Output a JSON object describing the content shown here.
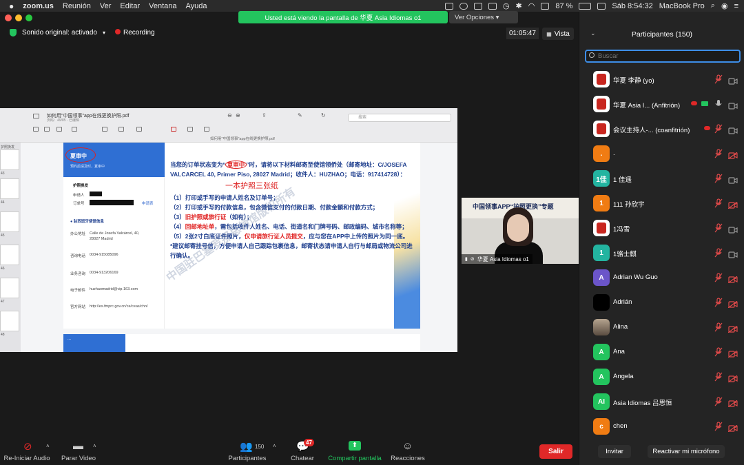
{
  "menubar": {
    "app_name": "zoom.us",
    "items": [
      "Reunión",
      "Ver",
      "Editar",
      "Ventana",
      "Ayuda"
    ],
    "battery": "87 %",
    "datetime": "Sáb 8:54:32",
    "device": "MacBook Pro"
  },
  "share_banner": {
    "text": "Usted está viendo la pantalla de 华夏 Asia Idiomas o1",
    "view_options": "Ver Opciones ▾"
  },
  "meeting": {
    "audio_status": "Sonido original: activado",
    "recording_label": "Recording",
    "timer": "01:05:47",
    "view_label": "Vista"
  },
  "shared_screen": {
    "pdf_title": "如何用\"中国领事\"app在线更换护照.pdf",
    "pdf_subtitle": "页码：49/85 · 已编辑",
    "pdf_filename": "如何用\"中国领事\"app在线更换护照.pdf",
    "search_placeholder": "搜索",
    "thumb_numbers": [
      "43",
      "44",
      "45",
      "46",
      "47",
      "48"
    ],
    "thumb_label": "护照换发",
    "phone": {
      "status": "夏审中",
      "status_sub": "预约后请及时，夏审中",
      "section1": "护照换发",
      "field_applicant": "申请人",
      "field_order": "订单号",
      "order_status": "申请表",
      "section2": "● 驻西班牙使馆信息",
      "addr_label": "办公地址",
      "addr_value": "Calle de Josefa Valcárcel, 40, 28027 Madrid",
      "tel1_label": "咨询电话",
      "tel1_value": "0034-915085096",
      "tel2_label": "业务咨询",
      "tel2_value": "0034-913206169",
      "email_label": "电子邮件",
      "email_value": "huzhaomadrid@vip.163.com",
      "web_label": "官方网站",
      "web_value": "http://es.fmprc.gov.cn/ce/ceas/chn/"
    },
    "body": {
      "p1a": "当您的订单状态变为“",
      "p1_status": "复审中",
      "p1b": "”时，请将以下材料邮寄至使馆领侨处（邮寄地址：C/JOSEFA VALCARCEL 40, Primer Piso, 28027 Madrid；收件人：HUZHAO；电话：917414728）：",
      "handwritten": "一本护照三张纸",
      "l1": "（1）打印或手写的申请人姓名及订单号；",
      "l2": "（2）打印或手写的付款信息，包含微信支付的付款日期、付款金额和付款方式；",
      "l3a": "（3）",
      "l3_red": "旧护照或旅行证",
      "l3b": "（如有）；",
      "l4a": "（4）",
      "l4_red": "回邮地址单",
      "l4b": "，需包括收件人姓名、电话、街道名和门牌号码、邮政编码、城市名称等；",
      "l5a": "（5）2张2寸白底证件照片，",
      "l5_red": "仅申请旅行证人员提交",
      "l5b": "，应与您在APP中上传的照片为同一底。",
      "note": "*建议邮寄挂号信，方便申请人自己跟踪包裹信息，邮寄状态请申请人自行与邮局或物流公司进行确认。"
    },
    "watermark": "中国驻巴塞罗那总领馆版权所有",
    "bottom_slide_label": "..."
  },
  "video": {
    "banner_text": "中国领事APP“护照更换”专题",
    "name": "华夏 Asia Idiomas o1"
  },
  "toolbar": {
    "audio": "Re-Iniciar Audio",
    "video": "Parar Video",
    "participants": "Participantes",
    "participants_count": "150",
    "chat": "Chatear",
    "chat_badge": "47",
    "share": "Compartir pantalla",
    "reactions": "Reacciones",
    "leave": "Salir"
  },
  "panel": {
    "title": "Participantes (150)",
    "search_placeholder": "Buscar",
    "invite": "Invitar",
    "unmute": "Reactivar mi micrófono",
    "participants": [
      {
        "name": "华夏 李静 (yo)",
        "avatar": "logo",
        "color": "#ffffff"
      },
      {
        "name": "华夏 Asia I...  (Anfitrión)",
        "avatar": "logo",
        "color": "#ffffff"
      },
      {
        "name": "会议主持人-...  (coanfitrión)",
        "avatar": "logo",
        "color": "#ffffff"
      },
      {
        "name": ".",
        "avatar": ".",
        "color": "#f07c13"
      },
      {
        "name": "1 佳遥",
        "avatar": "1佳",
        "color": "#23b4a0"
      },
      {
        "name": "111 孙欣宇",
        "avatar": "1",
        "color": "#f07c13"
      },
      {
        "name": "1冯雪",
        "avatar": "logo",
        "color": "#ffffff"
      },
      {
        "name": "1骆士麒",
        "avatar": "1",
        "color": "#23b4a0"
      },
      {
        "name": "Adrian Wu Guo",
        "avatar": "A",
        "color": "#6b55c9"
      },
      {
        "name": "Adrián",
        "avatar": "",
        "color": "#000000"
      },
      {
        "name": "Alina",
        "avatar": "photo",
        "color": "#8a7a6a"
      },
      {
        "name": "Ana",
        "avatar": "A",
        "color": "#23c45e"
      },
      {
        "name": "Angela",
        "avatar": "A",
        "color": "#23c45e"
      },
      {
        "name": "Asia Idiomas 吕思恒",
        "avatar": "AI",
        "color": "#23c45e"
      },
      {
        "name": "chen",
        "avatar": "c",
        "color": "#f07c13"
      }
    ]
  }
}
